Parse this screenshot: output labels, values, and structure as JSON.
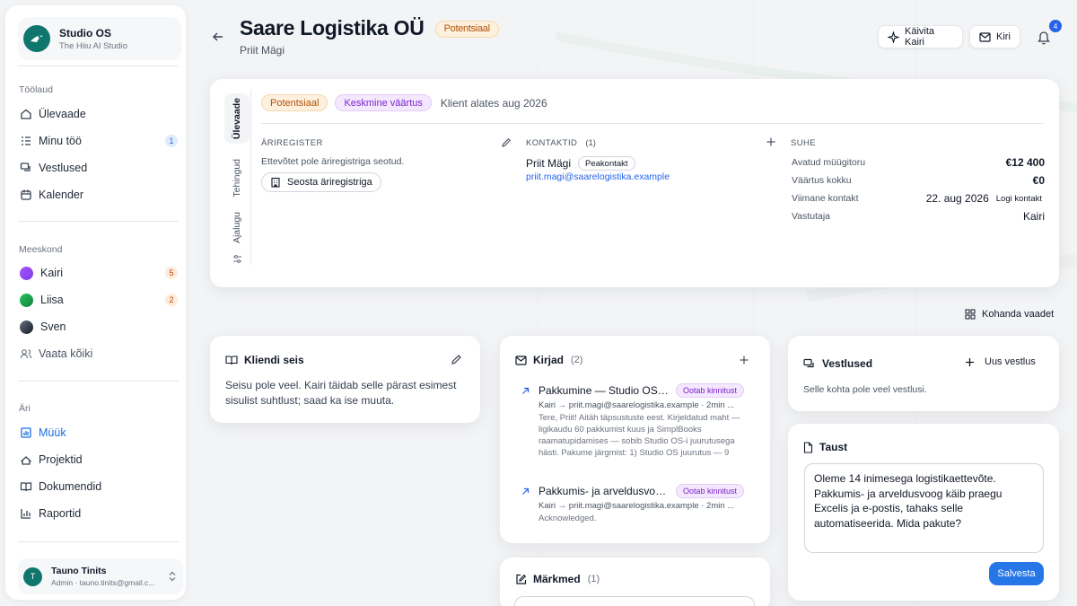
{
  "sidebar": {
    "brand": {
      "name": "Studio OS",
      "subtitle": "The Hiiu AI Studio"
    },
    "sections": [
      {
        "label": "Töölaud",
        "items": [
          {
            "label": "Ülevaade",
            "icon": "home-icon"
          },
          {
            "label": "Minu töö",
            "icon": "list-icon",
            "badge": "1"
          },
          {
            "label": "Vestlused",
            "icon": "chat-icon"
          },
          {
            "label": "Kalender",
            "icon": "calendar-icon"
          }
        ]
      },
      {
        "label": "Meeskond",
        "items": [
          {
            "label": "Kairi",
            "badge": "5"
          },
          {
            "label": "Liisa",
            "badge": "2"
          },
          {
            "label": "Sven"
          },
          {
            "label": "Vaata kõiki",
            "icon": "users-icon"
          }
        ]
      },
      {
        "label": "Äri",
        "items": [
          {
            "label": "Müük",
            "icon": "chart-icon",
            "active": true
          },
          {
            "label": "Projektid",
            "icon": "projects-icon"
          },
          {
            "label": "Dokumendid",
            "icon": "book-icon"
          },
          {
            "label": "Raportid",
            "icon": "report-icon"
          }
        ]
      }
    ],
    "user": {
      "initial": "T",
      "name": "Tauno Tinits",
      "subtitle": "Admin · tauno.tinits@gmail.c..."
    }
  },
  "header": {
    "title": "Saare Logistika OÜ",
    "status": "Potentsiaal",
    "subtitle": "Priit Mägi",
    "launch_button": "Käivita Kairi",
    "mail_button": "Kiri",
    "notification_count": "4"
  },
  "overview": {
    "tabs": [
      "Ülevaade",
      "Tehingud",
      "Ajalugu"
    ],
    "tags": [
      "Potentsiaal",
      "Keskmine väärtus"
    ],
    "client_since": "Klient alates aug 2026",
    "registry": {
      "heading": "ÄRIREGISTER",
      "empty": "Ettevõtet pole äriregistriga seotud.",
      "button": "Seosta äriregistriga"
    },
    "contacts": {
      "heading": "KONTAKTID",
      "count": "(1)",
      "name": "Priit Mägi",
      "role": "Peakontakt",
      "email": "priit.magi@saarelogistika.example"
    },
    "relation": {
      "heading": "SUHE",
      "rows": [
        {
          "key": "Avatud müügitoru",
          "value": "€12 400"
        },
        {
          "key": "Väärtus kokku",
          "value": "€0"
        },
        {
          "key": "Viimane kontakt",
          "value": "22. aug 2026",
          "action": "Logi kontakt"
        },
        {
          "key": "Vastutaja",
          "value": "Kairi"
        }
      ]
    }
  },
  "customize_button": "Kohanda vaadet",
  "client_state": {
    "title": "Kliendi seis",
    "text": "Seisu pole veel. Kairi täidab selle pärast esimest sisulist suhtlust; saad ka ise muuta."
  },
  "letters": {
    "title": "Kirjad",
    "count": "(2)",
    "items": [
      {
        "subject": "Pakkumine — Studio OS j...",
        "status": "Ootab kinnitust",
        "meta": "Kairi → priit.magi@saarelogistika.example · 2min ...",
        "body": "Tere, Priit! Aitäh täpsustuste eest. Kirjeldatud maht — ligikaudu 60 pakkumist kuus ja SimplBooks raamatupidamises — sobib Studio OS-i juurutusega hästi. Pakume järgmist: 1) Studio OS juurutus — 9"
      },
      {
        "subject": "Pakkumis- ja arveldusvoo...",
        "status": "Ootab kinnitust",
        "meta": "Kairi → priit.magi@saarelogistika.example · 2min ...",
        "body": "Acknowledged."
      }
    ]
  },
  "notes": {
    "title": "Märkmed",
    "count": "(1)"
  },
  "conversations": {
    "title": "Vestlused",
    "new_button": "Uus vestlus",
    "empty": "Selle kohta pole veel vestlusi."
  },
  "background": {
    "title": "Taust",
    "text": "Oleme 14 inimesega logistikaettevõte. Pakkumis- ja arveldusvoog käib praegu Excelis ja e-postis, tahaks selle automatiseerida. Mida pakute?",
    "save_button": "Salvesta"
  },
  "colors": {
    "accent": "#2676e8",
    "brand": "#0f766e",
    "warning": "#b45309",
    "purple": "#7e22ce"
  }
}
